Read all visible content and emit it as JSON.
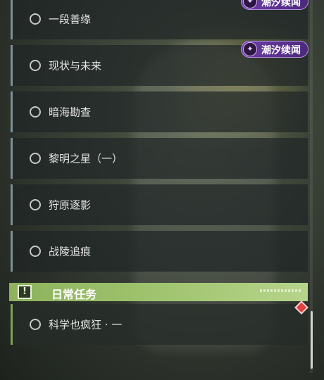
{
  "event_badge": {
    "label": "潮汐续闻",
    "icon": "tide-event-icon",
    "color": "#6f3ca8"
  },
  "quests": [
    {
      "label": "一段善缘"
    },
    {
      "label": "现状与未来"
    },
    {
      "label": "暗海勘查"
    },
    {
      "label": "黎明之星（一）"
    },
    {
      "label": "狩原逐影"
    },
    {
      "label": "战陵追痕"
    }
  ],
  "daily_section": {
    "title": "日常任务",
    "icon": "exclamation-icon",
    "color": "#8db25e",
    "items": [
      {
        "label": "科学也疯狂 · 一"
      }
    ]
  },
  "colors": {
    "quest_accent": "#7d8f95",
    "daily_accent": "#7fa05a",
    "alert": "#e0403f"
  }
}
